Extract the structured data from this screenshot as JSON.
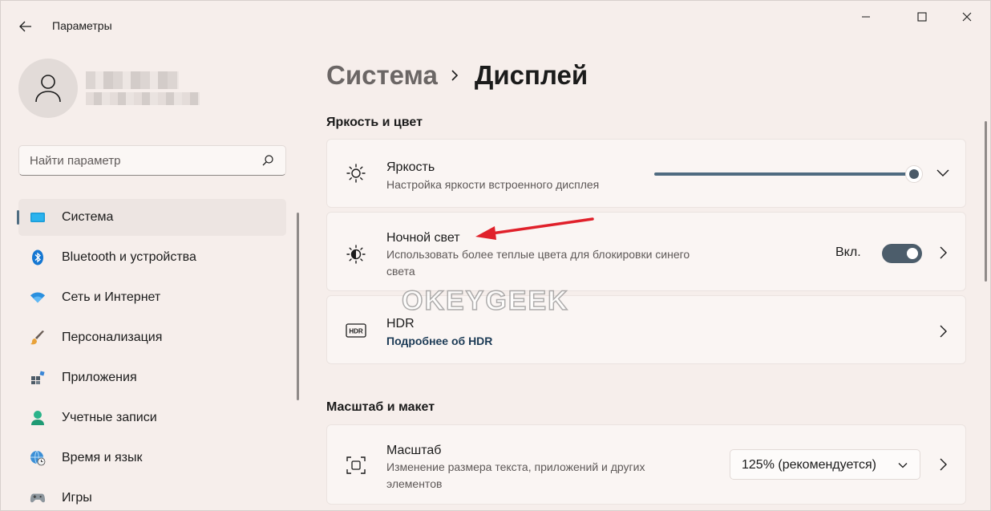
{
  "window": {
    "title": "Параметры",
    "controls": {
      "minimize_icon": "minimize-icon",
      "maximize_icon": "maximize-icon",
      "close_icon": "close-icon"
    }
  },
  "search": {
    "placeholder": "Найти параметр",
    "icon": "search-icon"
  },
  "sidebar": {
    "items": [
      {
        "label": "Система",
        "icon": "display-icon",
        "active": true
      },
      {
        "label": "Bluetooth и устройства",
        "icon": "bluetooth-icon"
      },
      {
        "label": "Сеть и Интернет",
        "icon": "wifi-icon"
      },
      {
        "label": "Персонализация",
        "icon": "brush-icon"
      },
      {
        "label": "Приложения",
        "icon": "apps-icon"
      },
      {
        "label": "Учетные записи",
        "icon": "user-icon"
      },
      {
        "label": "Время и язык",
        "icon": "globe-clock-icon"
      },
      {
        "label": "Игры",
        "icon": "gamepad-icon"
      }
    ]
  },
  "breadcrumb": {
    "parent": "Система",
    "current": "Дисплей"
  },
  "sections": {
    "brightness_color": {
      "title": "Яркость и цвет",
      "brightness": {
        "title": "Яркость",
        "subtitle": "Настройка яркости встроенного дисплея",
        "value_percent": 100
      },
      "night_light": {
        "title": "Ночной свет",
        "subtitle": "Использовать более теплые цвета для блокировки синего",
        "subtitle2": "света",
        "toggle_label": "Вкл.",
        "enabled": true
      },
      "hdr": {
        "title": "HDR",
        "link": "Подробнее об HDR"
      }
    },
    "scale_layout": {
      "title": "Масштаб и макет",
      "scale": {
        "title": "Масштаб",
        "subtitle": "Изменение размера текста, приложений и других",
        "subtitle2": "элементов",
        "value": "125% (рекомендуется)"
      }
    }
  },
  "watermark": "OKEYGEEK",
  "colors": {
    "accent": "#4f6b80",
    "arrow": "#e0202a",
    "background": "#f6eeeb"
  }
}
